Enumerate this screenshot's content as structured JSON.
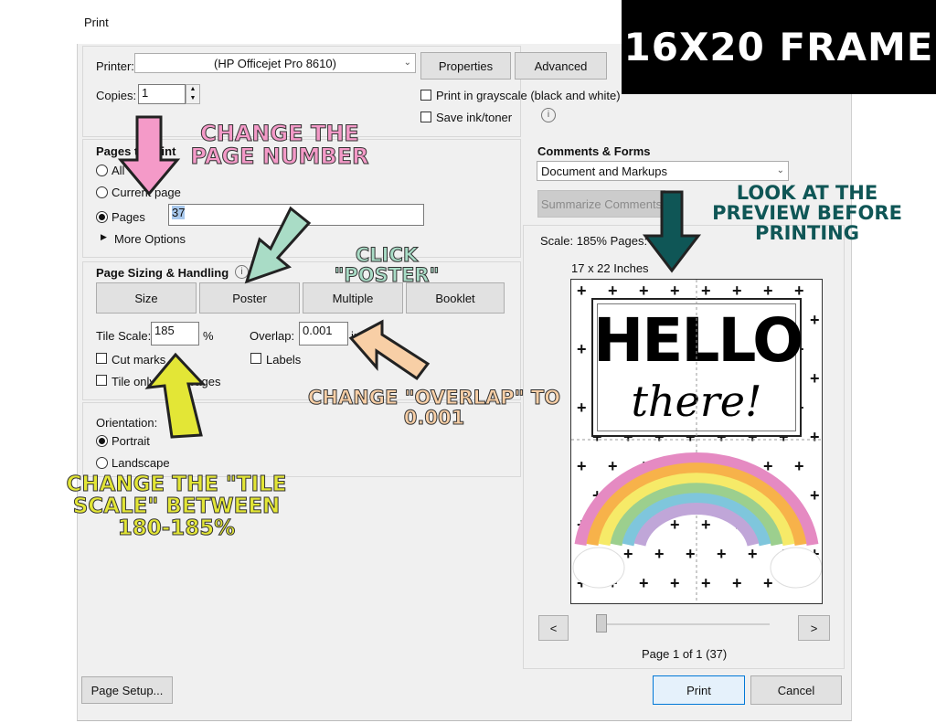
{
  "window": {
    "title": "Print"
  },
  "banner": {
    "text": "16X20 FRAME"
  },
  "printer": {
    "label": "Printer:",
    "value": "(HP Officejet Pro 8610)",
    "properties": "Properties",
    "advanced": "Advanced"
  },
  "copies": {
    "label": "Copies:",
    "value": "1"
  },
  "options": {
    "grayscale": "Print in grayscale (black and white)",
    "save_ink": "Save ink/toner"
  },
  "pages_to_print": {
    "title": "Pages to Print",
    "all": "All",
    "current": "Current page",
    "pages": "Pages",
    "pages_value": "37",
    "more_options": "More Options"
  },
  "sizing": {
    "title": "Page Sizing & Handling",
    "tabs": [
      "Size",
      "Poster",
      "Multiple",
      "Booklet"
    ],
    "tile_scale_label": "Tile Scale:",
    "tile_scale_value": "185",
    "percent": "%",
    "overlap_label": "Overlap:",
    "overlap_value": "0.001",
    "overlap_unit": "in",
    "cut_marks": "Cut marks",
    "labels": "Labels",
    "tile_large": "Tile only large pages"
  },
  "orientation": {
    "title": "Orientation:",
    "portrait": "Portrait",
    "landscape": "Landscape"
  },
  "comments": {
    "title": "Comments & Forms",
    "value": "Document and Markups",
    "summarize": "Summarize Comments"
  },
  "preview": {
    "scale": "Scale: 185% Pages: 4",
    "size": "17 x 22 Inches",
    "hello": "HELLO",
    "there": "there!",
    "prev": "<",
    "next": ">",
    "page_info": "Page 1 of 1 (37)"
  },
  "footer": {
    "page_setup": "Page Setup...",
    "print": "Print",
    "cancel": "Cancel"
  },
  "annotations": {
    "change_page": "CHANGE THE PAGE NUMBER",
    "click_poster": "CLICK \"POSTER\"",
    "look_preview": "LOOK AT THE PREVIEW BEFORE PRINTING",
    "overlap": "CHANGE \"OVERLAP\" TO 0.001",
    "tile_scale": "CHANGE THE \"TILE SCALE\" BETWEEN 180-185%"
  },
  "colors": {
    "pink": "#f49ac8",
    "mint": "#a9dcc6",
    "teal": "#0f5656",
    "peach": "#f8cfa6",
    "yellow": "#e3e636"
  }
}
